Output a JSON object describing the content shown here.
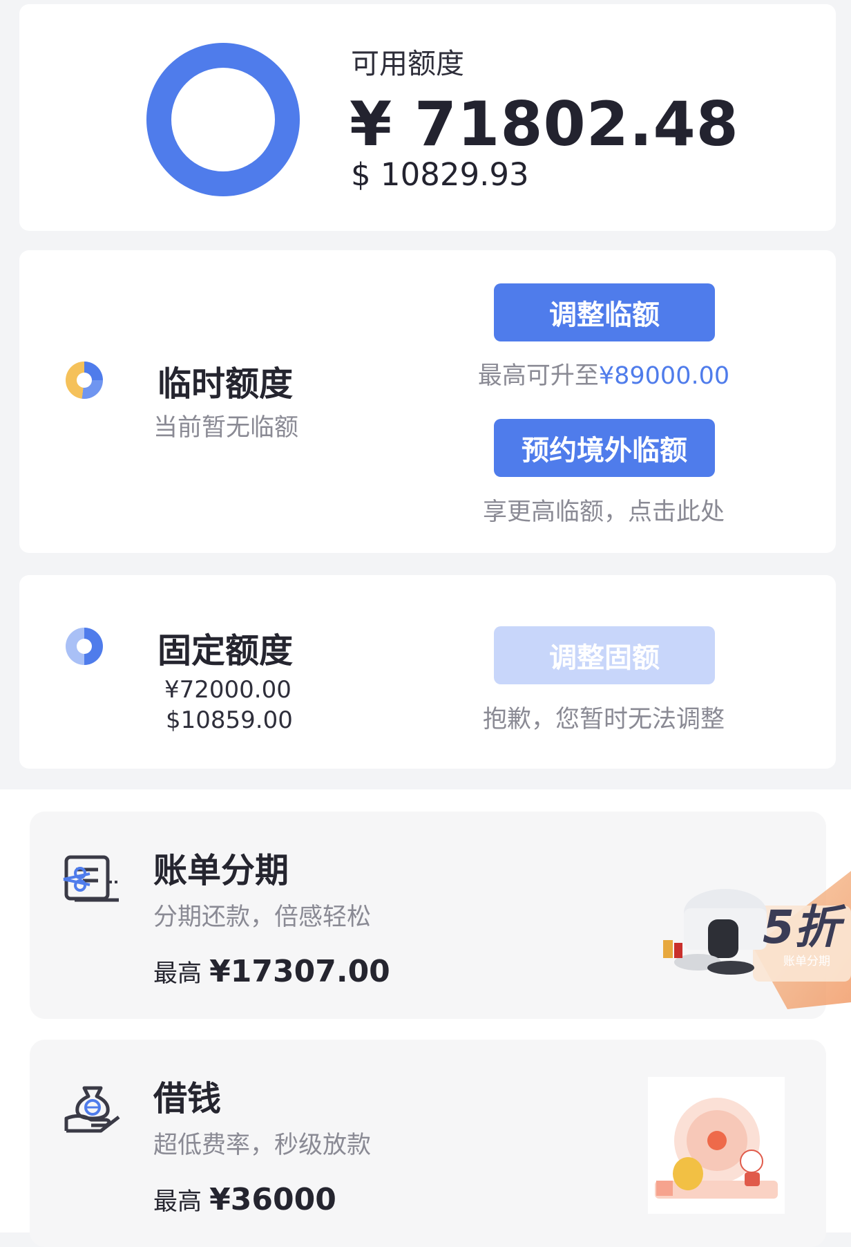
{
  "available": {
    "label": "可用额度",
    "amount_cny": "¥ 71802.48",
    "amount_usd": "$ 10829.93",
    "ring_color": "#4f7ceb"
  },
  "temporary": {
    "title": "临时额度",
    "subtitle": "当前暂无临额",
    "adjust_button": "调整临额",
    "max_prefix": "最高可升至",
    "max_value": "¥89000.00",
    "overseas_button": "预约境外临额",
    "overseas_note": "享更高临额，点击此处"
  },
  "fixed": {
    "title": "固定额度",
    "amount_cny": "¥72000.00",
    "amount_usd": "$10859.00",
    "adjust_button": "调整固额",
    "note": "抱歉，您暂时无法调整"
  },
  "installment": {
    "title": "账单分期",
    "subtitle": "分期还款，倍感轻松",
    "max_label": "最高",
    "max_value": "¥17307.00",
    "badge_discount": "5折",
    "badge_label": "账单分期",
    "icon": "bill-scissors-icon"
  },
  "borrow": {
    "title": "借钱",
    "subtitle": "超低费率，秒级放款",
    "max_label": "最高",
    "max_value": "¥36000",
    "icon": "money-bag-hand-icon"
  },
  "colors": {
    "accent": "#4f7ceb",
    "accent_disabled": "#c8d6fa",
    "temp_segment": "#f5c15a"
  }
}
